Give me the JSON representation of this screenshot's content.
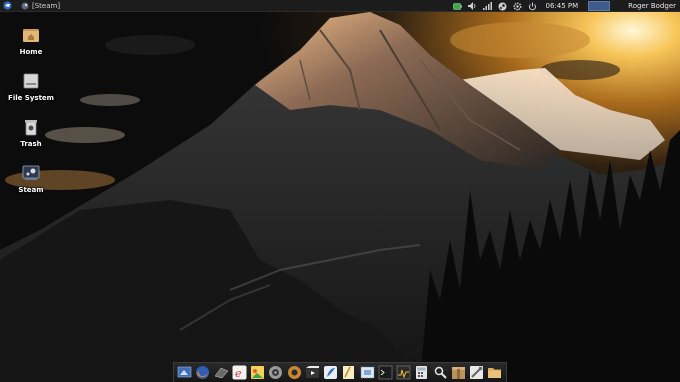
{
  "top_panel": {
    "task_title": "[Steam]",
    "clock": "06:45 PM",
    "user": "Roger Bodger",
    "tray_icons": [
      "battery-icon",
      "volume-icon",
      "network-signal-icon",
      "steam-tray-icon",
      "settings-icon",
      "power-icon"
    ]
  },
  "desktop_icons": [
    {
      "label": "Home",
      "icon": "home-folder-icon"
    },
    {
      "label": "File System",
      "icon": "drive-icon"
    },
    {
      "label": "Trash",
      "icon": "trash-icon"
    },
    {
      "label": "Steam",
      "icon": "steam-icon"
    }
  ],
  "dock": {
    "items": [
      "desktop-icon",
      "firefox-icon",
      "terminal-window-icon",
      "browser-e-icon",
      "image-viewer-icon",
      "disc-icon",
      "media-player-icon",
      "video-icon",
      "inkscape-icon",
      "notes-icon",
      "screenshot-icon",
      "console-icon",
      "system-monitor-icon",
      "calculator-icon",
      "search-icon",
      "archive-icon",
      "tools-icon",
      "folder-icon"
    ]
  }
}
